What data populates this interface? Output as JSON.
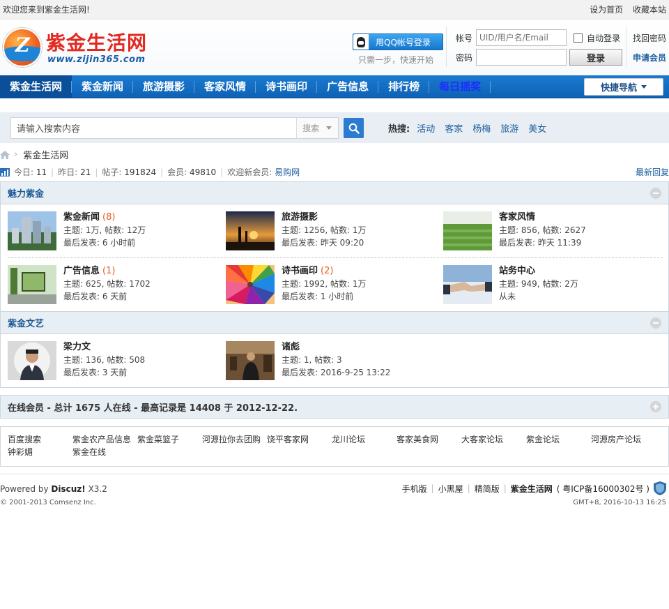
{
  "topbar": {
    "welcome": "欢迎您来到紫金生活网!",
    "set_home": "设为首页",
    "bookmark": "收藏本站"
  },
  "header": {
    "logo_title": "紫金生活网",
    "logo_url": "www.zijin365.com",
    "qq_login": "用QQ帐号登录",
    "qq_sub": "只需一步，快速开始",
    "account_label": "帐号",
    "account_placeholder": "UID/用户名/Email",
    "password_label": "密码",
    "auto_login": "自动登录",
    "login_button": "登录",
    "find_password": "找回密码",
    "register": "申请会员"
  },
  "nav": {
    "items": [
      {
        "label": "紫金生活网"
      },
      {
        "label": "紫金新闻"
      },
      {
        "label": "旅游摄影"
      },
      {
        "label": "客家风情"
      },
      {
        "label": "诗书画印"
      },
      {
        "label": "广告信息"
      },
      {
        "label": "排行榜"
      },
      {
        "label": "每日摇奖"
      }
    ],
    "quick_nav": "快捷导航"
  },
  "search": {
    "placeholder": "请输入搜索内容",
    "type": "搜索",
    "hot_label": "热搜:",
    "hot_words": [
      "活动",
      "客家",
      "杨梅",
      "旅游",
      "美女"
    ]
  },
  "breadcrumb": {
    "current": "紫金生活网"
  },
  "stats": {
    "today_label": "今日:",
    "today": "11",
    "yesterday_label": "昨日:",
    "yesterday": "21",
    "posts_label": "帖子:",
    "posts": "191824",
    "members_label": "会员:",
    "members": "49810",
    "new_member_label": "欢迎新会员:",
    "new_member": "易购网",
    "latest_reply": "最新回复"
  },
  "section1": {
    "title": "魅力紫金",
    "forums": [
      {
        "name": "紫金新闻",
        "new": "(8)",
        "threads": "主题: 1万, 帖数: 12万",
        "last": "最后发表: 6 小时前"
      },
      {
        "name": "旅游摄影",
        "new": "",
        "threads": "主题: 1256, 帖数: 1万",
        "last": "最后发表: 昨天 09:20"
      },
      {
        "name": "客家风情",
        "new": "",
        "threads": "主题: 856, 帖数: 2627",
        "last": "最后发表: 昨天 11:39"
      },
      {
        "name": "广告信息",
        "new": "(1)",
        "threads": "主题: 625, 帖数: 1702",
        "last": "最后发表: 6 天前"
      },
      {
        "name": "诗书画印",
        "new": "(2)",
        "threads": "主题: 1992, 帖数: 1万",
        "last": "最后发表: 1 小时前"
      },
      {
        "name": "站务中心",
        "new": "",
        "threads": "主题: 949, 帖数: 2万",
        "last": "从未"
      }
    ]
  },
  "section2": {
    "title": "紫金文艺",
    "forums": [
      {
        "name": "梁力文",
        "new": "",
        "threads": "主题: 136, 帖数: 508",
        "last": "最后发表: 3 天前"
      },
      {
        "name": "诸彪",
        "new": "",
        "threads": "主题: 1, 帖数: 3",
        "last": "最后发表: 2016-9-25 13:22"
      }
    ]
  },
  "online": {
    "text": "在线会员 - 总计 1675 人在线 - 最高记录是 14408 于 2012-12-22."
  },
  "friend_links": [
    "百度搜索",
    "紫金农产品信息",
    "紫金菜篮子",
    "河源拉你去团购",
    "饶平客家网",
    "龙川论坛",
    "客家美食网",
    "大客家论坛",
    "紫金论坛",
    "河源房产论坛",
    "钟彩媚",
    "紫金在线"
  ],
  "footer": {
    "powered_prefix": "Powered by",
    "powered_brand": "Discuz!",
    "powered_version": "X3.2",
    "copyright": "© 2001-2013 Comsenz Inc.",
    "mobile": "手机版",
    "blackroom": "小黑屋",
    "simple": "精简版",
    "site": "紫金生活网",
    "icp": "( 粤ICP备16000302号 )",
    "gmt": "GMT+8, 2016-10-13 16:25"
  },
  "colors": {
    "nav_bg": "#1270c4",
    "link_blue": "#1e5f9e",
    "new_count": "#e85a1d",
    "logo_red": "#e3281f"
  }
}
